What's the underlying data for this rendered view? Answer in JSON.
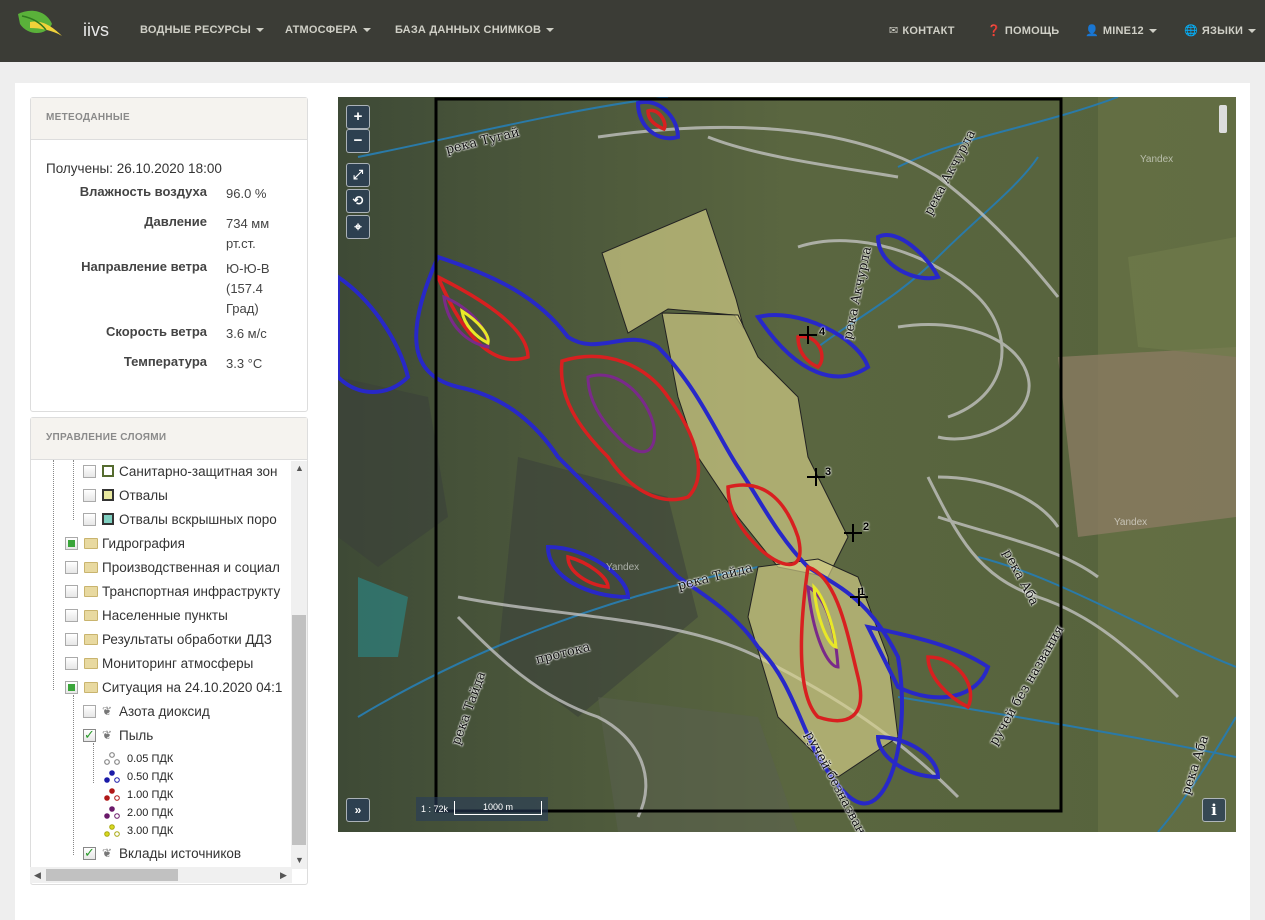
{
  "navbar": {
    "brand": "iivs",
    "menu": [
      {
        "label": "ВОДНЫЕ РЕСУРСЫ"
      },
      {
        "label": "АТМОСФЕРА"
      },
      {
        "label": "БАЗА ДАННЫХ СНИМКОВ"
      }
    ],
    "contact": "КОНТАКТ",
    "help": "ПОМОЩЬ",
    "user": "MINE12",
    "languages": "ЯЗЫКИ"
  },
  "meteo": {
    "title": "МЕТЕОДАННЫЕ",
    "received": "Получены: 26.10.2020 18:00",
    "rows": [
      {
        "label": "Влажность воздуха",
        "value": "96.0 %"
      },
      {
        "label": "Давление",
        "value": "734 мм рт.ст."
      },
      {
        "label": "Направление ветра",
        "value": "Ю-Ю-В (157.4 Град)"
      },
      {
        "label": "Скорость ветра",
        "value": "3.6 м/с"
      },
      {
        "label": "Температура",
        "value": "3.3 °C"
      }
    ]
  },
  "layers": {
    "title": "УПРАВЛЕНИЕ СЛОЯМИ",
    "items": [
      {
        "label": "Санитарно-защитная зон",
        "color": "#556b2f"
      },
      {
        "label": "Отвалы",
        "color": "#d8d890"
      },
      {
        "label": "Отвалы вскрышных поро",
        "color": "#7fcfc0"
      },
      {
        "label": "Гидрография"
      },
      {
        "label": "Производственная и социал"
      },
      {
        "label": "Транспортная инфраструкту"
      },
      {
        "label": "Населенные пункты"
      },
      {
        "label": "Результаты обработки ДДЗ"
      },
      {
        "label": "Мониторинг атмосферы"
      },
      {
        "label": "Ситуация на 24.10.2020 04:1"
      },
      {
        "label": "Азота диоксид"
      },
      {
        "label": "Пыль"
      },
      {
        "label": "Вклады источников"
      }
    ],
    "pdk": [
      {
        "label": "0.05 ПДК",
        "color": "#999999"
      },
      {
        "label": "0.50 ПДК",
        "color": "#1a1aa8"
      },
      {
        "label": "1.00 ПДК",
        "color": "#b01818"
      },
      {
        "label": "2.00 ПДК",
        "color": "#6a1a6a"
      },
      {
        "label": "3.00 ПДК",
        "color": "#d8d820"
      }
    ]
  },
  "map": {
    "scale_ratio": "1 : 72k",
    "scale_distance": "1000 m",
    "watermark": "Yandex",
    "labels": [
      {
        "text": "река Тугай"
      },
      {
        "text": "река Акчурла"
      },
      {
        "text": "река Акчурла"
      },
      {
        "text": "река Тайда"
      },
      {
        "text": "протока"
      },
      {
        "text": "река Тайда"
      },
      {
        "text": "ручей безназванный"
      },
      {
        "text": "река Аба"
      },
      {
        "text": "ручей без названия"
      },
      {
        "text": "река Аба"
      }
    ],
    "markers": [
      "1",
      "2",
      "3",
      "4"
    ]
  }
}
